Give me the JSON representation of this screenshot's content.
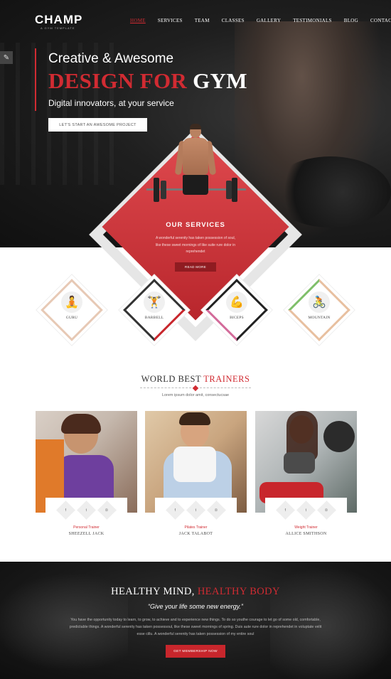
{
  "brand": {
    "logo": "CHAMP",
    "tagline": "A GYM TEMPLATE",
    "accent": "#d12b32"
  },
  "nav": [
    "HOME",
    "SERVICES",
    "TEAM",
    "CLASSES",
    "GALLERY",
    "TESTIMONIALS",
    "BLOG",
    "CONTACT"
  ],
  "hero": {
    "line1": "Creative & Awesome",
    "line2_red": "DESIGN FOR",
    "line2_white": "GYM",
    "line3": "Digital innovators, at your service",
    "cta": "LET'S START AN AWESOME PROJECT"
  },
  "services": {
    "title": "OUR SERVICES",
    "text": "A wonderful serenity has taken possession of soul, like these sweet mornings of like suite rure dolor in reprehendet",
    "button": "READ MORE"
  },
  "classes": [
    {
      "label": "GURU",
      "icon": "yoga-icon",
      "glyph": "🧘"
    },
    {
      "label": "BARBELL",
      "icon": "barbell-icon",
      "glyph": "🏋"
    },
    {
      "label": "BICEPS",
      "icon": "biceps-icon",
      "glyph": "💪"
    },
    {
      "label": "MOUNTAIN",
      "icon": "cycling-icon",
      "glyph": "🚴"
    }
  ],
  "trainers_section": {
    "title_dark": "WORLD BEST",
    "title_red": "TRAINERS",
    "subtitle": "Lorem ipsum dolor amit, consectucsae"
  },
  "trainers": [
    {
      "role": "Personal Trainer",
      "name": "SHEEZELL JACK"
    },
    {
      "role": "Pilates Trainer",
      "name": "JACK TALABOT"
    },
    {
      "role": "Weight Trainer",
      "name": "ALLICE SMITHSON"
    }
  ],
  "social": {
    "facebook": "f",
    "twitter": "t",
    "dribbble": "◎"
  },
  "banner": {
    "title_white": "HEALTHY MIND,",
    "title_red": "HEALTHY BODY",
    "quote": "“Give your life some new energy.”",
    "text": "You have the opportunity today to learn, to grow, to achieve and to experience new things. To do so youthe courage to let go of some old, comfortable, predictable things. A wonderful serenity has taken possessoul, like these sweet mornings of spring. Duis aute rure dolor in reprehendet in voluptate velit esse cillu. A wonderful serenity has taken possession of my entire soul",
    "button": "GET MEMBERSHIP NOW"
  }
}
